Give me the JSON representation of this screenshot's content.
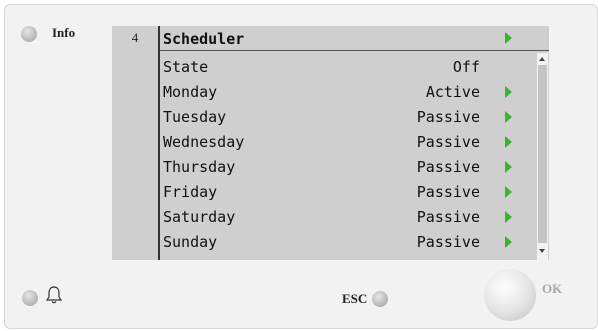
{
  "device": {
    "info_label": "Info",
    "esc_label": "ESC",
    "ok_label": "OK",
    "alarm_icon": "bell-icon"
  },
  "screen": {
    "page_number": "4",
    "title": "Scheduler",
    "rows": [
      {
        "name": "State",
        "value": "Off",
        "has_arrow": false
      },
      {
        "name": "Monday",
        "value": "Active",
        "has_arrow": true
      },
      {
        "name": "Tuesday",
        "value": "Passive",
        "has_arrow": true
      },
      {
        "name": "Wednesday",
        "value": "Passive",
        "has_arrow": true
      },
      {
        "name": "Thursday",
        "value": "Passive",
        "has_arrow": true
      },
      {
        "name": "Friday",
        "value": "Passive",
        "has_arrow": true
      },
      {
        "name": "Saturday",
        "value": "Passive",
        "has_arrow": true
      },
      {
        "name": "Sunday",
        "value": "Passive",
        "has_arrow": true
      }
    ]
  },
  "colors": {
    "arrow": "#3bb330",
    "screen_bg": "#cfcfcf",
    "panel_bg": "#f2f2f2"
  }
}
